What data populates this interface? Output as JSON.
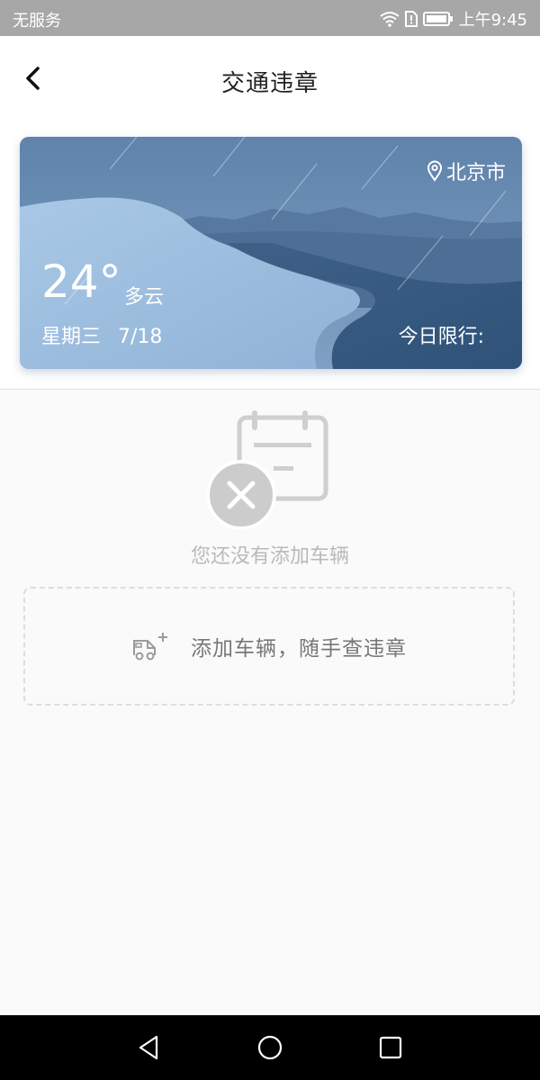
{
  "status": {
    "carrier": "无服务",
    "time": "上午9:45"
  },
  "header": {
    "title": "交通违章"
  },
  "weather": {
    "city": "北京市",
    "temperature": "24°",
    "condition": "多云",
    "date": "星期三 7/18",
    "limit_label": "今日限行:"
  },
  "empty": {
    "message": "您还没有添加车辆"
  },
  "add_vehicle": {
    "label": "添加车辆，随手查违章"
  },
  "icons": {
    "back": "chevron-left-icon",
    "location": "location-pin-icon",
    "empty": "calendar-cross-icon",
    "add_car": "truck-plus-icon"
  },
  "colors": {
    "card_dark": "#4f6f93",
    "card_light": "#8fb2d6",
    "accent_gray": "#cfcfcf"
  }
}
